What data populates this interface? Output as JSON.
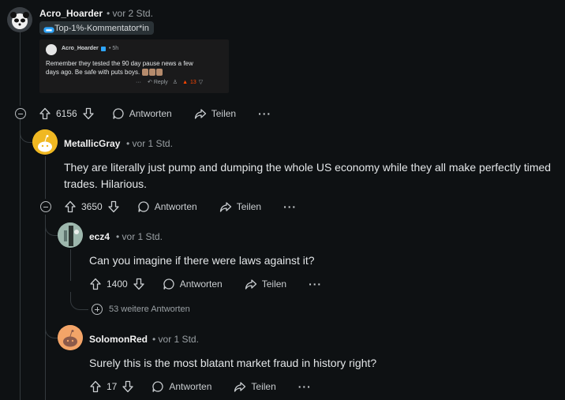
{
  "op": {
    "author": "Acro_Hoarder",
    "time": "vor 2 Std.",
    "flair": "Top-1%-Kommentator*in",
    "embed": {
      "author": "Acro_Hoarder",
      "time": "5h",
      "text_line1": "Remember they tested the 90 day pause news a few",
      "text_line2": "days ago.  Be safe with puts boys.",
      "reply_label": "Reply",
      "score": "13"
    },
    "score": "6156",
    "reply_label": "Antworten",
    "share_label": "Teilen",
    "more": "···"
  },
  "comments": [
    {
      "author": "MetallicGray",
      "time": "vor 1 Std.",
      "text": "They are literally just pump and dumping the whole US economy while they all make perfectly timed trades. Hilarious.",
      "score": "3650",
      "reply_label": "Antworten",
      "share_label": "Teilen",
      "more": "···"
    },
    {
      "author": "ecz4",
      "time": "vor 1 Std.",
      "text": "Can you imagine if there were laws against it?",
      "score": "1400",
      "reply_label": "Antworten",
      "share_label": "Teilen",
      "more": "···"
    },
    {
      "author": "SolomonRed",
      "time": "vor 1 Std.",
      "text": "Surely this is the most blatant market fraud in history right?",
      "score": "17",
      "reply_label": "Antworten",
      "share_label": "Teilen",
      "more": "···"
    }
  ],
  "more_replies": "53 weitere Antworten",
  "separator": "•",
  "colors": {
    "background": "#0e1113",
    "upvote_active": "#ff4500",
    "flair_bg": "#2a3236"
  }
}
